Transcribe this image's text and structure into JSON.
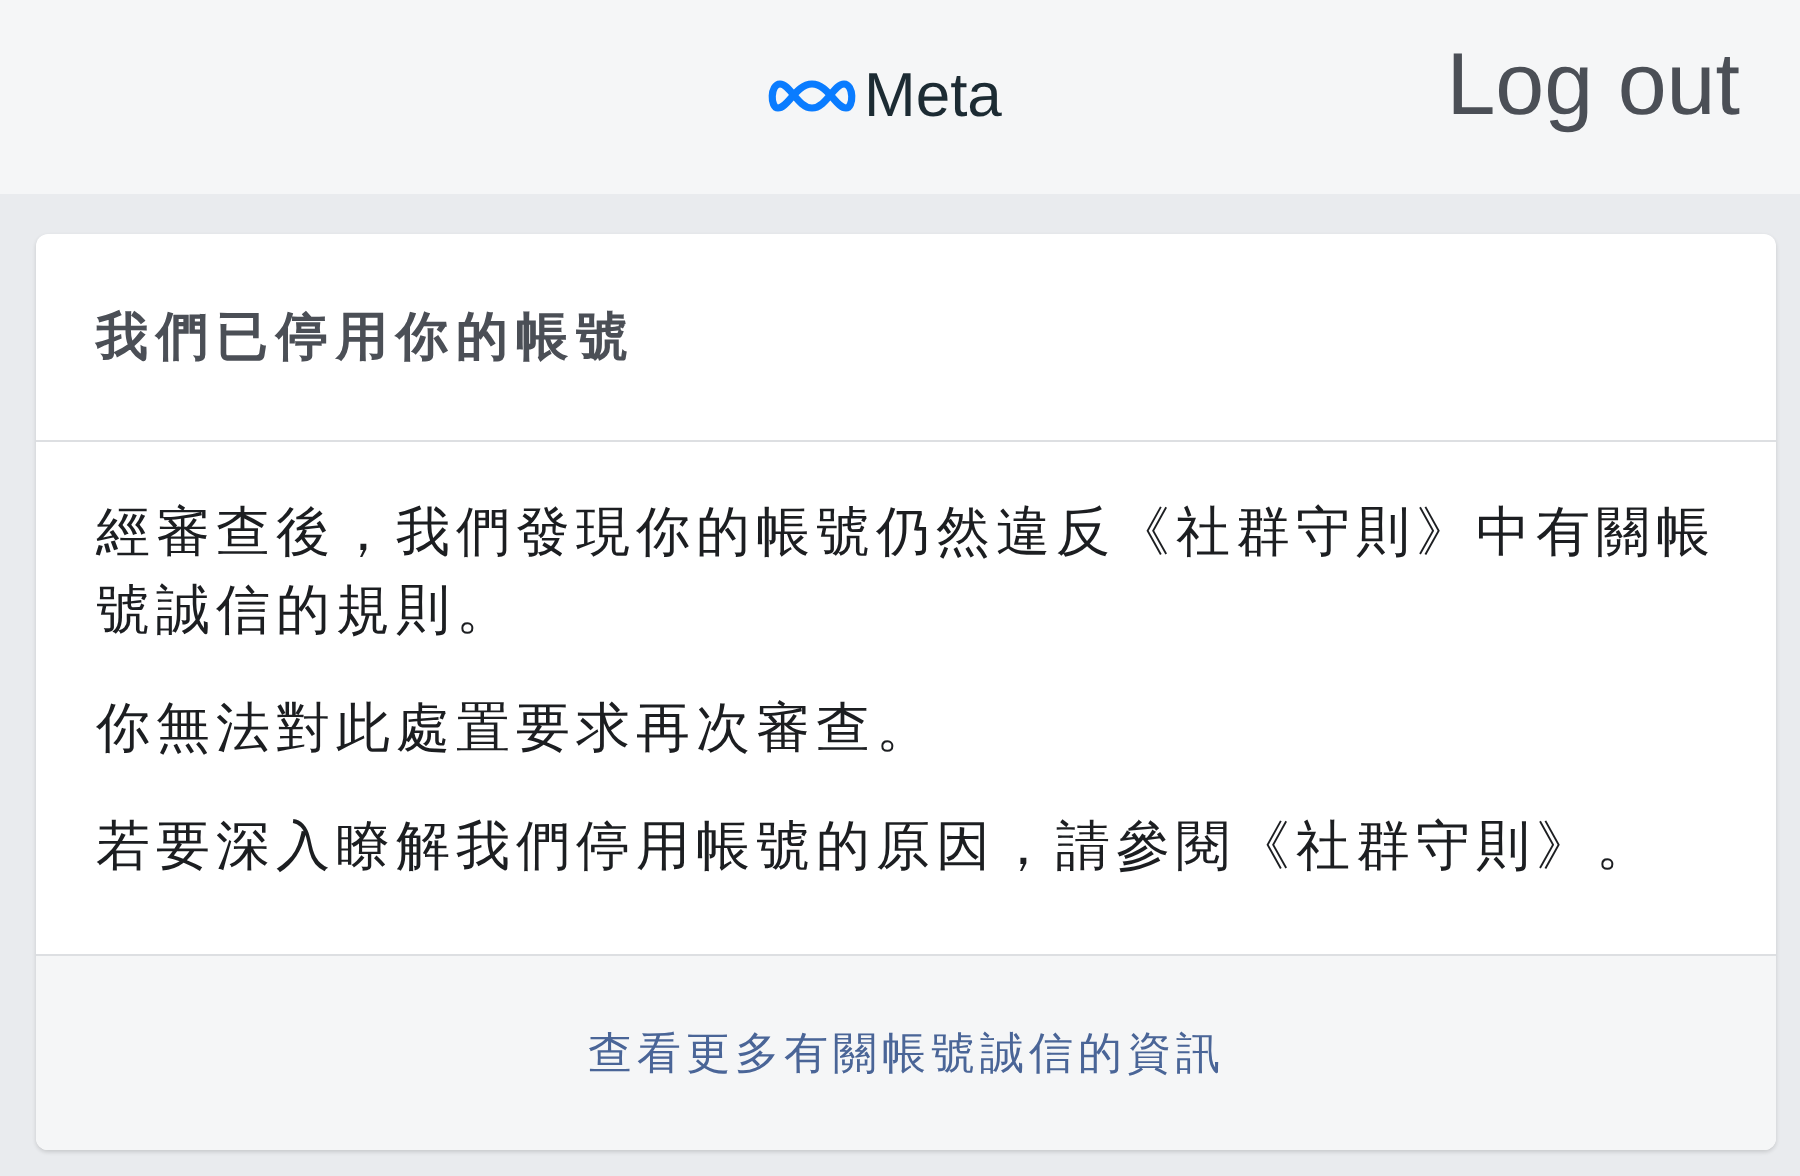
{
  "header": {
    "brand": "Meta",
    "logout": "Log out"
  },
  "card": {
    "title": "我們已停用你的帳號",
    "paragraphs": [
      "經審查後，我們發現你的帳號仍然違反《社群守則》中有關帳號誠信的規則。",
      "你無法對此處置要求再次審查。",
      "若要深入瞭解我們停用帳號的原因，請參閱《社群守則》。"
    ],
    "footer_link": "查看更多有關帳號誠信的資訊"
  }
}
